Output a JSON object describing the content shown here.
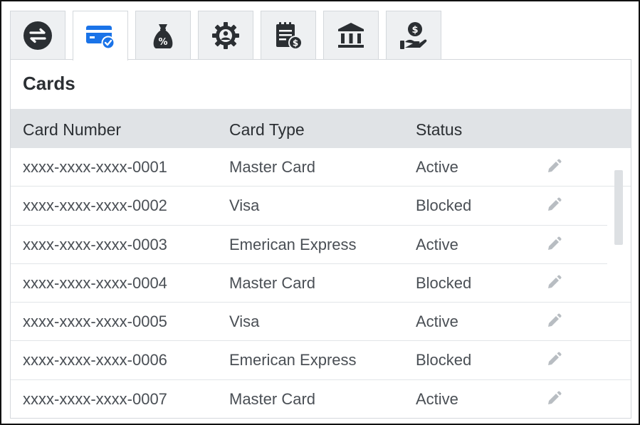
{
  "tabs": [
    {
      "icon": "transfer-icon",
      "active": false
    },
    {
      "icon": "card-check-icon",
      "active": true
    },
    {
      "icon": "money-bag-percent-icon",
      "active": false
    },
    {
      "icon": "gear-icon",
      "active": false
    },
    {
      "icon": "bill-dollar-icon",
      "active": false
    },
    {
      "icon": "bank-icon",
      "active": false
    },
    {
      "icon": "hand-dollar-icon",
      "active": false
    }
  ],
  "panel": {
    "title": "Cards"
  },
  "table": {
    "columns": [
      "Card Number",
      "Card Type",
      "Status"
    ],
    "rows": [
      {
        "number": "xxxx-xxxx-xxxx-0001",
        "type": "Master Card",
        "status": "Active"
      },
      {
        "number": "xxxx-xxxx-xxxx-0002",
        "type": "Visa",
        "status": "Blocked"
      },
      {
        "number": "xxxx-xxxx-xxxx-0003",
        "type": "Emerican Express",
        "status": "Active"
      },
      {
        "number": "xxxx-xxxx-xxxx-0004",
        "type": "Master Card",
        "status": "Blocked"
      },
      {
        "number": "xxxx-xxxx-xxxx-0005",
        "type": "Visa",
        "status": "Active"
      },
      {
        "number": "xxxx-xxxx-xxxx-0006",
        "type": "Emerican Express",
        "status": "Blocked"
      },
      {
        "number": "xxxx-xxxx-xxxx-0007",
        "type": "Master Card",
        "status": "Active"
      }
    ]
  },
  "colors": {
    "icon_dark": "#2b2f33",
    "icon_active": "#1a73e8",
    "tab_bg": "#eef0f2",
    "header_bg": "#e0e3e6"
  }
}
